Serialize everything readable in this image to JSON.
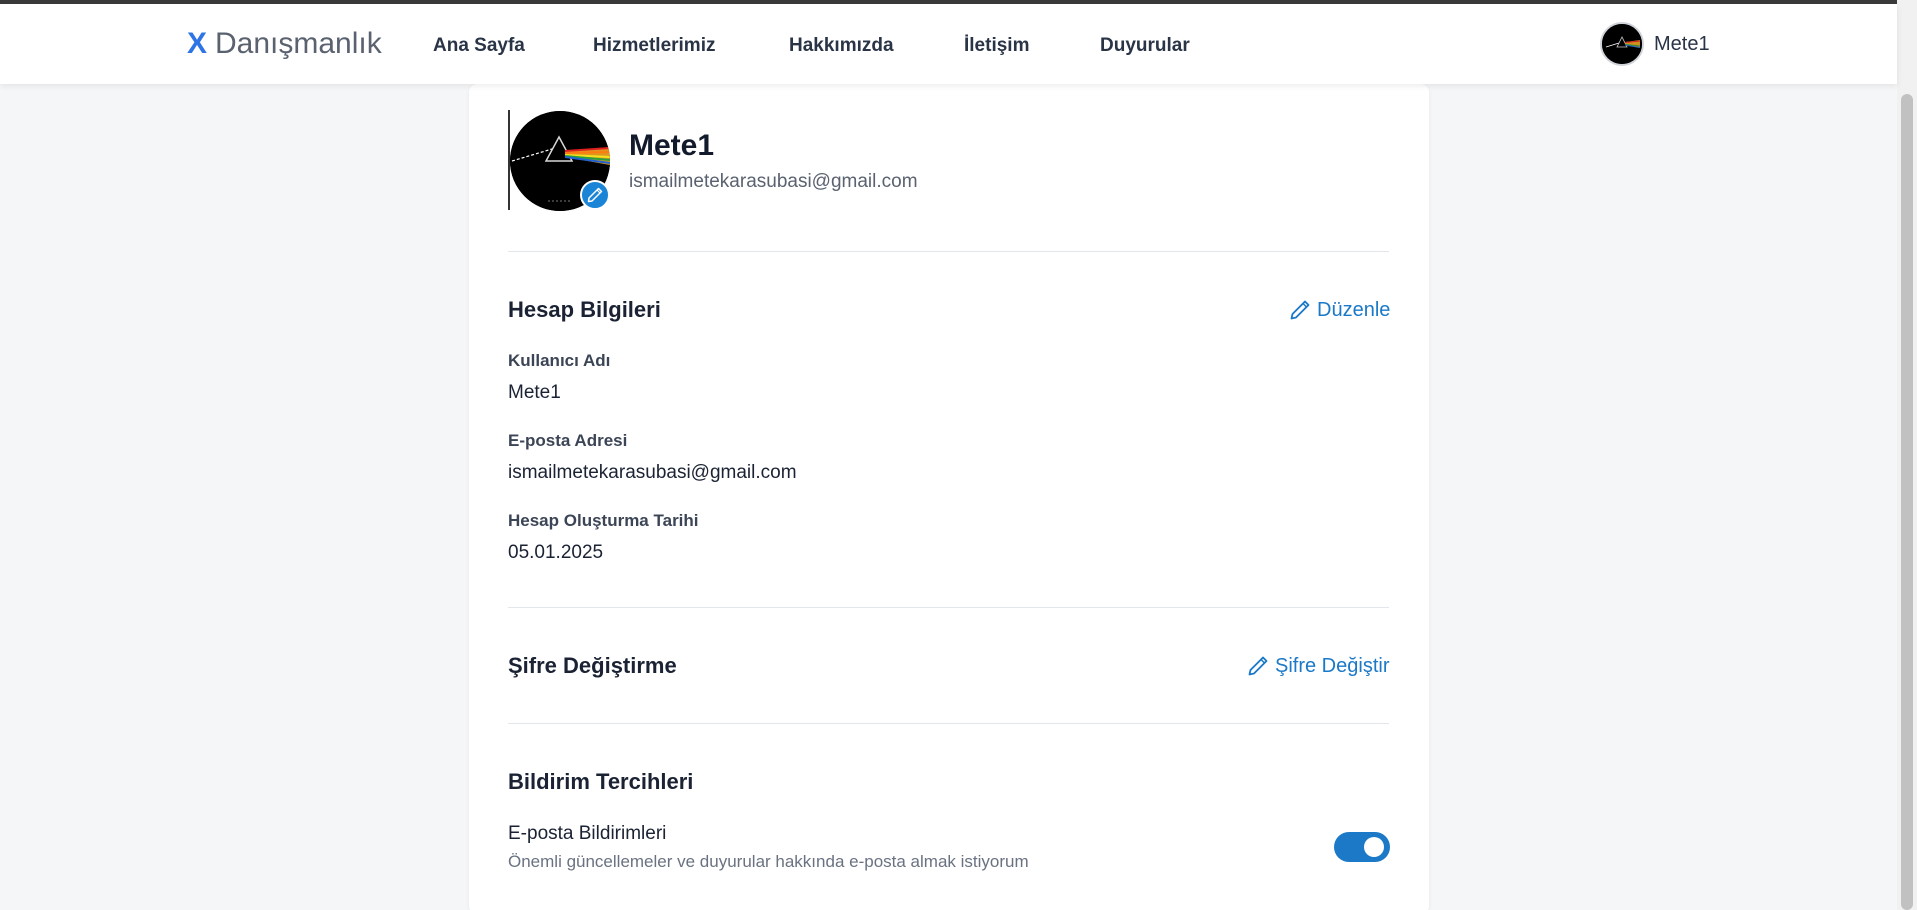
{
  "brand": {
    "x": "X",
    "name": "Danışmanlık"
  },
  "nav": {
    "items": [
      {
        "label": "Ana Sayfa"
      },
      {
        "label": "Hizmetlerimiz"
      },
      {
        "label": "Hakkımızda"
      },
      {
        "label": "İletişim"
      },
      {
        "label": "Duyurular"
      }
    ],
    "user": {
      "name": "Mete1",
      "avatar_icon": "prism-album-avatar"
    }
  },
  "profile": {
    "name": "Mete1",
    "email": "ismailmetekarasubasi@gmail.com",
    "avatar_icon": "prism-album-avatar",
    "edit_icon": "pencil-icon"
  },
  "account": {
    "title": "Hesap Bilgileri",
    "edit_label": "Düzenle",
    "fields": [
      {
        "label": "Kullanıcı Adı",
        "value": "Mete1"
      },
      {
        "label": "E-posta Adresi",
        "value": "ismailmetekarasubasi@gmail.com"
      },
      {
        "label": "Hesap Oluşturma Tarihi",
        "value": "05.01.2025"
      }
    ]
  },
  "password": {
    "title": "Şifre Değiştirme",
    "action_label": "Şifre Değiştir"
  },
  "notifications": {
    "title": "Bildirim Tercihleri",
    "email_pref": {
      "title": "E-posta Bildirimleri",
      "description": "Önemli güncellemeler ve duyurular hakkında e-posta almak istiyorum",
      "enabled": true
    }
  },
  "colors": {
    "accent": "#1b79c7",
    "brand_x": "#2f74e6",
    "background": "#f5f6f8"
  }
}
